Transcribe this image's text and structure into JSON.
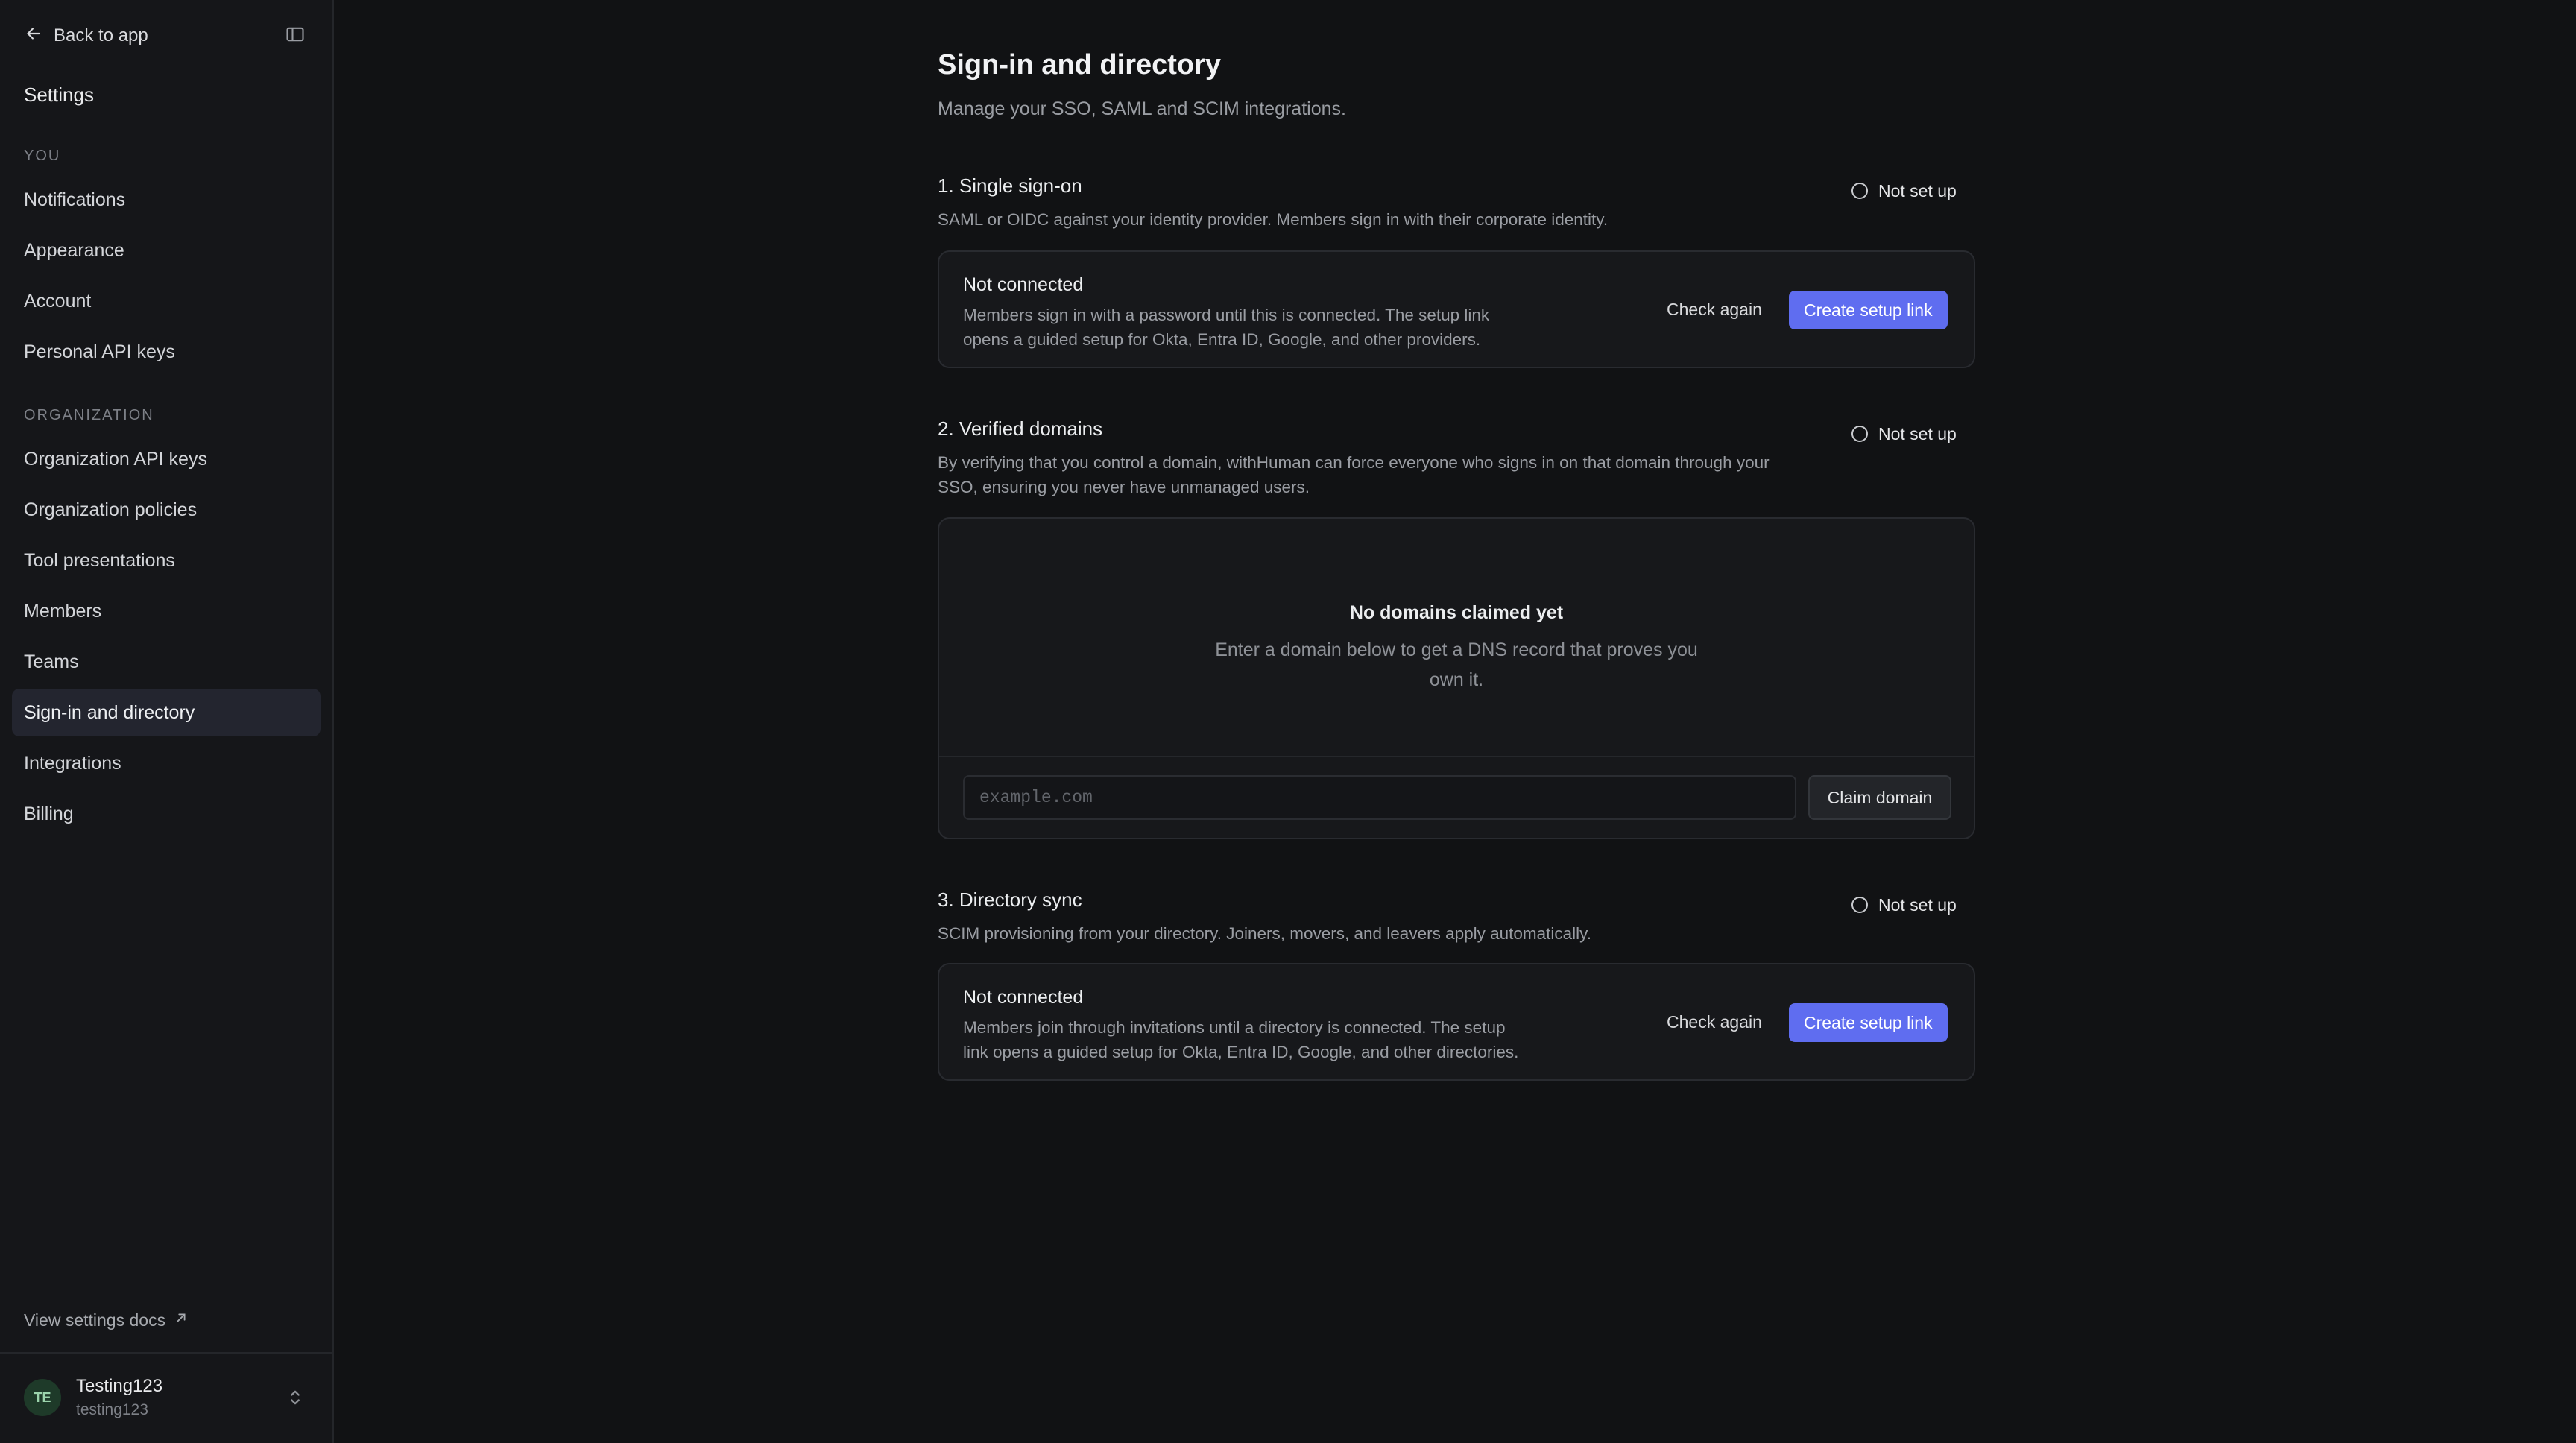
{
  "sidebar": {
    "back_label": "Back to app",
    "title": "Settings",
    "sections": [
      {
        "label": "You",
        "items": [
          {
            "label": "Notifications"
          },
          {
            "label": "Appearance"
          },
          {
            "label": "Account"
          },
          {
            "label": "Personal API keys"
          }
        ]
      },
      {
        "label": "Organization",
        "items": [
          {
            "label": "Organization API keys"
          },
          {
            "label": "Organization policies"
          },
          {
            "label": "Tool presentations"
          },
          {
            "label": "Members"
          },
          {
            "label": "Teams"
          },
          {
            "label": "Sign-in and directory",
            "active": true
          },
          {
            "label": "Integrations"
          },
          {
            "label": "Billing"
          }
        ]
      }
    ],
    "docs_link": "View settings docs",
    "user": {
      "initials": "TE",
      "name": "Testing123",
      "handle": "testing123"
    }
  },
  "page": {
    "title": "Sign-in and directory",
    "subtitle": "Manage your SSO, SAML and SCIM integrations."
  },
  "sections": {
    "sso": {
      "heading": "1. Single sign-on",
      "description": "SAML or OIDC against your identity provider. Members sign in with their corporate identity.",
      "status": "Not set up",
      "card": {
        "title": "Not connected",
        "body": "Members sign in with a password until this is connected. The setup link opens a guided setup for Okta, Entra ID, Google, and other providers.",
        "check_again": "Check again",
        "create_link": "Create setup link"
      }
    },
    "domains": {
      "heading": "2. Verified domains",
      "description": "By verifying that you control a domain, withHuman can force everyone who signs in on that domain through your SSO, ensuring you never have unmanaged users.",
      "status": "Not set up",
      "empty_title": "No domains claimed yet",
      "empty_body": "Enter a domain below to get a DNS record that proves you own it.",
      "input_placeholder": "example.com",
      "input_value": "",
      "claim_button": "Claim domain"
    },
    "directory": {
      "heading": "3. Directory sync",
      "description": "SCIM provisioning from your directory. Joiners, movers, and leavers apply automatically.",
      "status": "Not set up",
      "card": {
        "title": "Not connected",
        "body": "Members join through invitations until a directory is connected. The setup link opens a guided setup for Okta, Entra ID, Google, and other directories.",
        "check_again": "Check again",
        "create_link": "Create setup link"
      }
    }
  },
  "colors": {
    "background": "#111214",
    "sidebar": "#151619",
    "accent": "#5f6df0",
    "active_nav": "#23252f"
  },
  "icons": {
    "back": "arrow-left-icon",
    "collapse": "sidebar-toggle-icon",
    "external": "external-link-icon",
    "user_menu": "chevron-up-down-icon",
    "status": "empty-circle-icon"
  }
}
